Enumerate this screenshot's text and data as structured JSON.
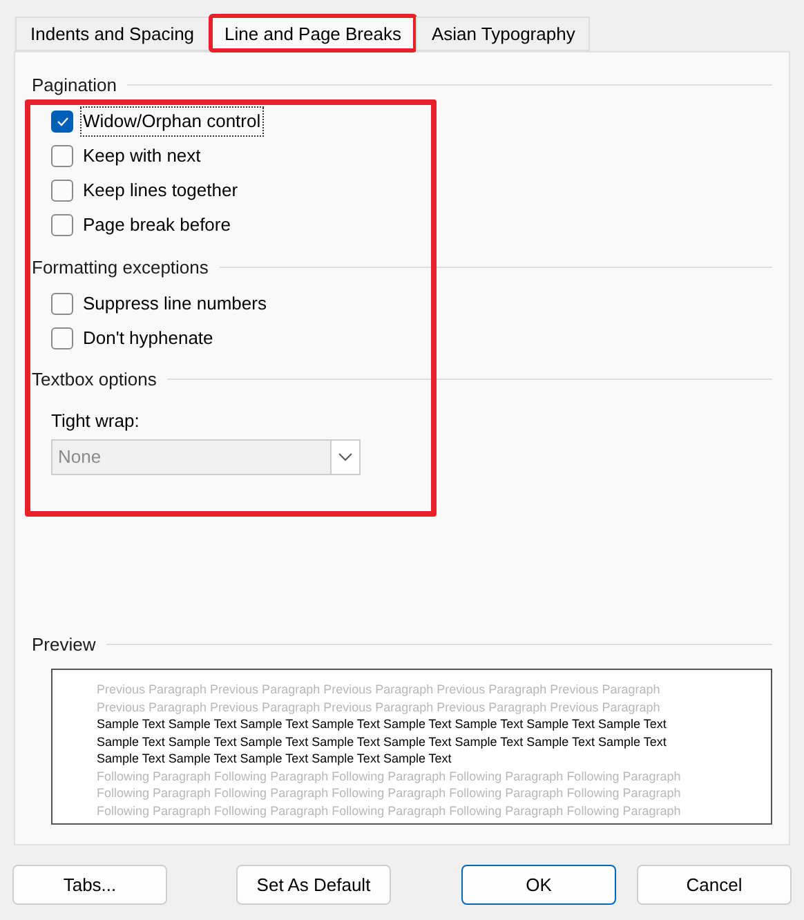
{
  "tabs": [
    {
      "label": "Indents and Spacing",
      "selected": false,
      "highlighted": false
    },
    {
      "label": "Line and Page Breaks",
      "selected": true,
      "highlighted": true
    },
    {
      "label": "Asian Typography",
      "selected": false,
      "highlighted": false
    }
  ],
  "options_highlighted": true,
  "sections": [
    {
      "title": "Pagination",
      "items": [
        {
          "label": "Widow/Orphan control",
          "checked": true,
          "focused": true
        },
        {
          "label": "Keep with next",
          "checked": false,
          "focused": false
        },
        {
          "label": "Keep lines together",
          "checked": false,
          "focused": false
        },
        {
          "label": "Page break before",
          "checked": false,
          "focused": false
        }
      ]
    },
    {
      "title": "Formatting exceptions",
      "items": [
        {
          "label": "Suppress line numbers",
          "checked": false,
          "focused": false
        },
        {
          "label": "Don't hyphenate",
          "checked": false,
          "focused": false
        }
      ]
    }
  ],
  "textbox_options": {
    "title": "Textbox options",
    "tight_wrap": {
      "label": "Tight wrap:",
      "value": "None",
      "disabled": true
    }
  },
  "preview": {
    "title": "Preview",
    "previous": "Previous Paragraph Previous Paragraph Previous Paragraph Previous Paragraph Previous Paragraph Previous Paragraph Previous Paragraph Previous Paragraph Previous Paragraph Previous Paragraph",
    "sample": "Sample Text Sample Text Sample Text Sample Text Sample Text Sample Text Sample Text Sample Text Sample Text Sample Text Sample Text Sample Text Sample Text Sample Text Sample Text Sample Text Sample Text Sample Text Sample Text Sample Text Sample Text",
    "following": "Following Paragraph Following Paragraph Following Paragraph Following Paragraph Following Paragraph Following Paragraph Following Paragraph Following Paragraph Following Paragraph Following Paragraph Following Paragraph Following Paragraph Following Paragraph Following Paragraph Following Paragraph"
  },
  "buttons": [
    {
      "label": "Tabs...",
      "default": false
    },
    {
      "label": "Set As Default",
      "default": false
    },
    {
      "label": "OK",
      "default": true
    },
    {
      "label": "Cancel",
      "default": false
    }
  ]
}
